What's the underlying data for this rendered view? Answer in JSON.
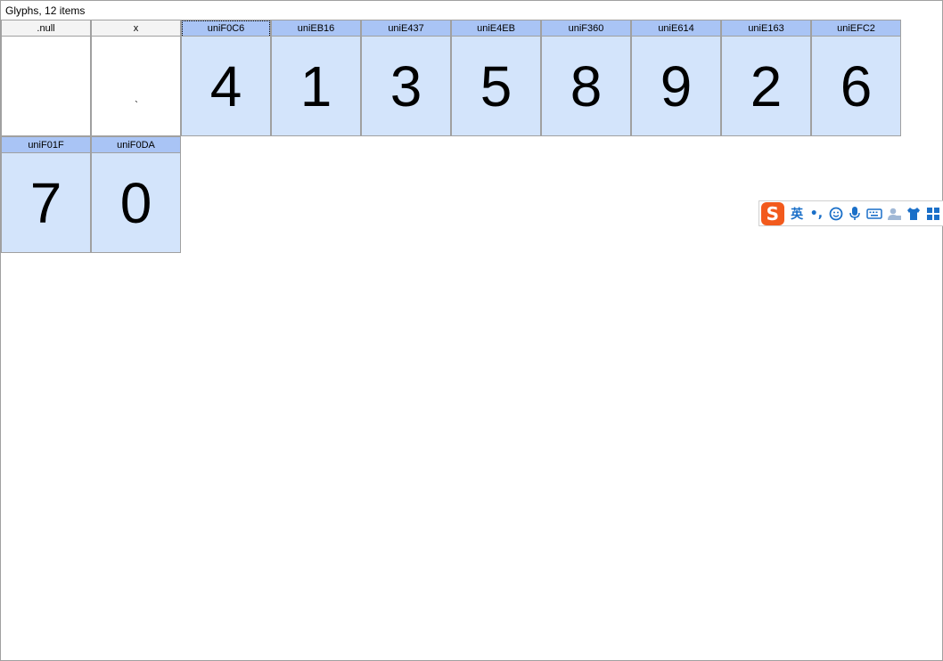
{
  "window": {
    "title": "Glyphs, 12 items"
  },
  "glyphs": [
    {
      "name": ".null",
      "char": "",
      "selected": false
    },
    {
      "name": "x",
      "char": "`",
      "selected": false
    },
    {
      "name": "uniF0C6",
      "char": "4",
      "selected": true
    },
    {
      "name": "uniEB16",
      "char": "1",
      "selected": true
    },
    {
      "name": "uniE437",
      "char": "3",
      "selected": true
    },
    {
      "name": "uniE4EB",
      "char": "5",
      "selected": true
    },
    {
      "name": "uniF360",
      "char": "8",
      "selected": true
    },
    {
      "name": "uniE614",
      "char": "9",
      "selected": true
    },
    {
      "name": "uniE163",
      "char": "2",
      "selected": true
    },
    {
      "name": "uniEFC2",
      "char": "6",
      "selected": true
    },
    {
      "name": "uniF01F",
      "char": "7",
      "selected": true
    },
    {
      "name": "uniF0DA",
      "char": "0",
      "selected": true
    }
  ],
  "ime_toolbar": {
    "logo": "S",
    "language": "英",
    "punctuation": "•,",
    "icons": [
      "logo-icon",
      "language-toggle",
      "punctuation-toggle",
      "emoji-icon",
      "microphone-icon",
      "keyboard-icon",
      "user-icon",
      "skin-shirt-icon",
      "menu-grid-icon"
    ]
  },
  "colors": {
    "selected_header": "#a9c4f5",
    "selected_body": "#d3e4fb",
    "ime_logo": "#f25a1d",
    "ime_icon": "#1a6fc8"
  }
}
